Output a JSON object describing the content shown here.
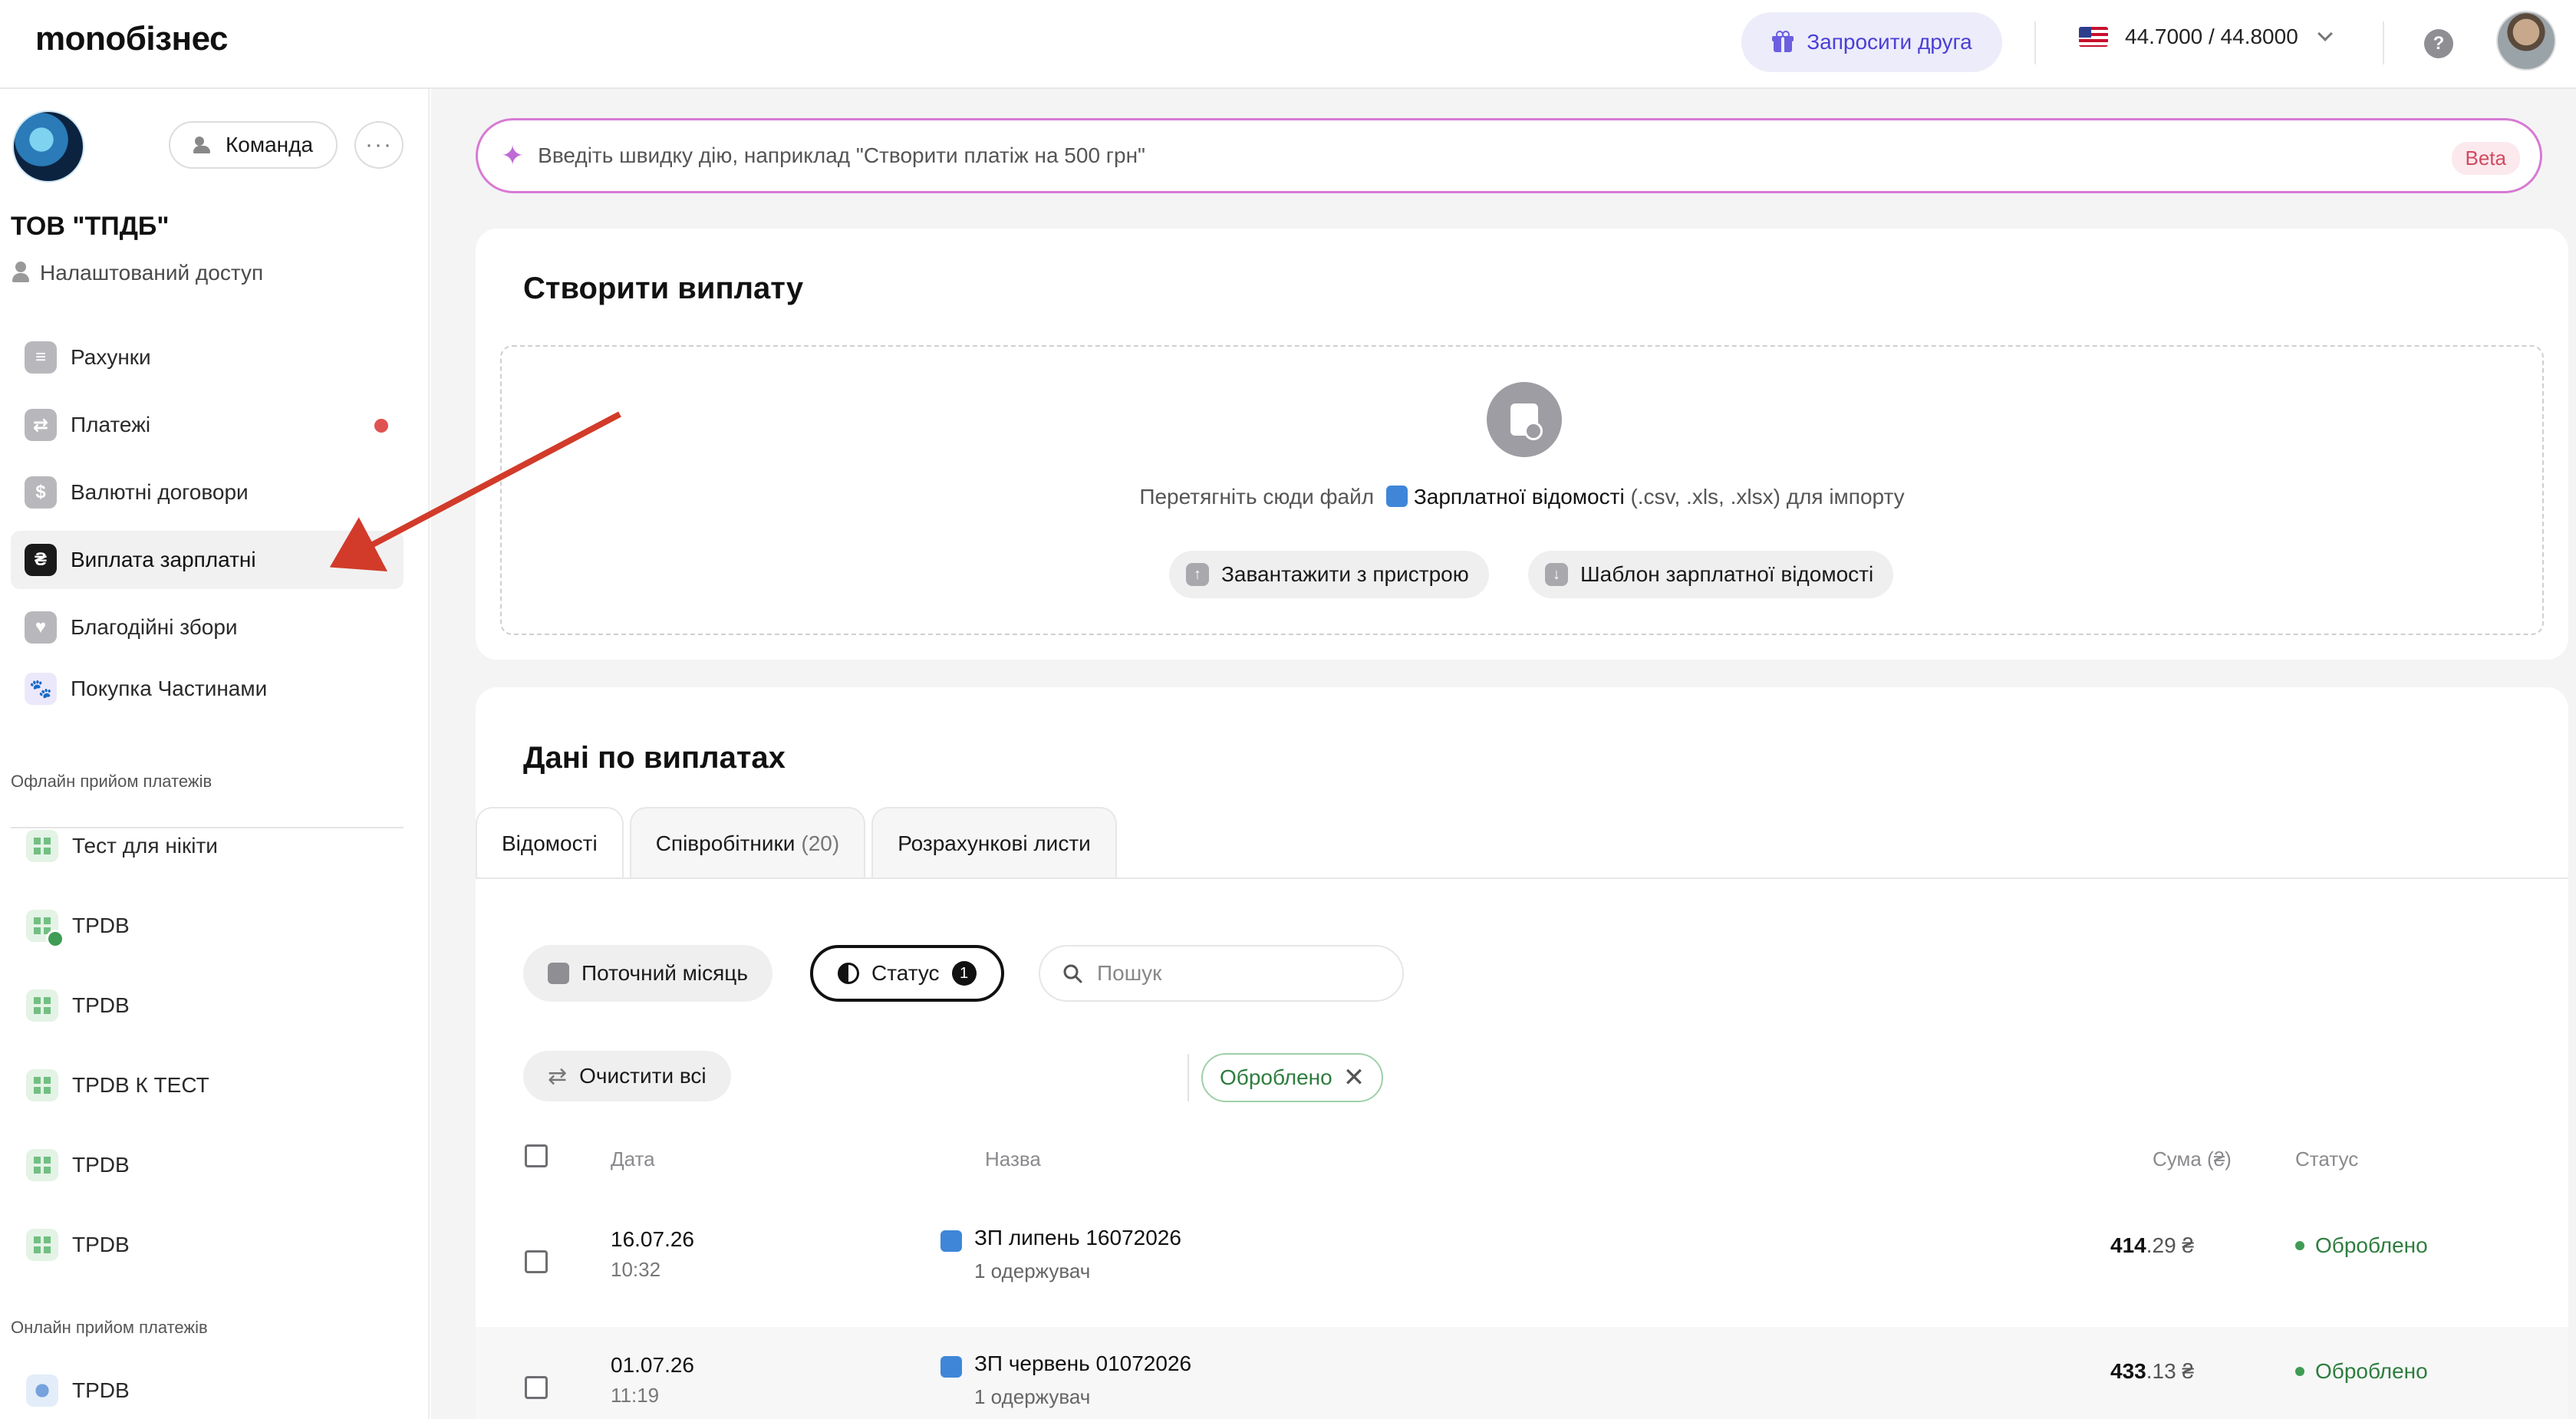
{
  "header": {
    "logo": "monoбізнес",
    "invite_label": "Запросити друга",
    "rate": "44.7000 / 44.8000"
  },
  "sidebar": {
    "team_label": "Команда",
    "org_name": "ТОВ \"ТПДБ\"",
    "access_label": "Налаштований доступ",
    "items": [
      {
        "label": "Рахунки"
      },
      {
        "label": "Платежі"
      },
      {
        "label": "Валютні договори"
      },
      {
        "label": "Виплата зарплатні"
      },
      {
        "label": "Благодійні збори"
      },
      {
        "label": "Покупка Частинами"
      }
    ],
    "offline_title": "Офлайн прийом платежів",
    "offline_items": [
      "Тест для нікіти",
      "TPDB",
      "TPDB",
      "TPDB К ТЕСТ",
      "TPDB",
      "TPDB"
    ],
    "online_title": "Онлайн прийом платежів",
    "online_items": [
      "TPDB"
    ]
  },
  "quick": {
    "placeholder": "Введіть швидку дію, наприклад \"Створити платіж на 500 грн\"",
    "beta": "Beta"
  },
  "create": {
    "title": "Створити виплату",
    "drop_prefix": "Перетягніть сюди файл",
    "drop_link": "Зарплатної відомості",
    "drop_suffix": "(.csv, .xls, .xlsx) для імпорту",
    "upload_label": "Завантажити з пристрою",
    "template_label": "Шаблон зарплатної відомості"
  },
  "payouts": {
    "title": "Дані по виплатах",
    "tabs": [
      {
        "label": "Відомості"
      },
      {
        "label": "Співробітники",
        "count": "(20)"
      },
      {
        "label": "Розрахункові листи"
      }
    ],
    "filters": {
      "month": "Поточний місяць",
      "status": "Статус",
      "status_count": "1",
      "search_placeholder": "Пошук",
      "clear": "Очистити всі",
      "chip": "Оброблено"
    },
    "columns": {
      "date": "Дата",
      "name": "Назва",
      "sum": "Сума (₴)",
      "status": "Статус"
    },
    "rows": [
      {
        "date": "16.07.26",
        "time": "10:32",
        "name": "ЗП липень 16072026",
        "sub": "1 одержувач",
        "sum_int": "414",
        "sum_dec": ".29 ₴",
        "status": "Оброблено"
      },
      {
        "date": "01.07.26",
        "time": "11:19",
        "name": "ЗП червень 01072026",
        "sub": "1 одержувач",
        "sum_int": "433",
        "sum_dec": ".13 ₴",
        "status": "Оброблено"
      }
    ]
  },
  "colors": {
    "accent": "#4a3fd6",
    "success": "#2e7d3e",
    "annotation_arrow": "#d23b2a"
  }
}
